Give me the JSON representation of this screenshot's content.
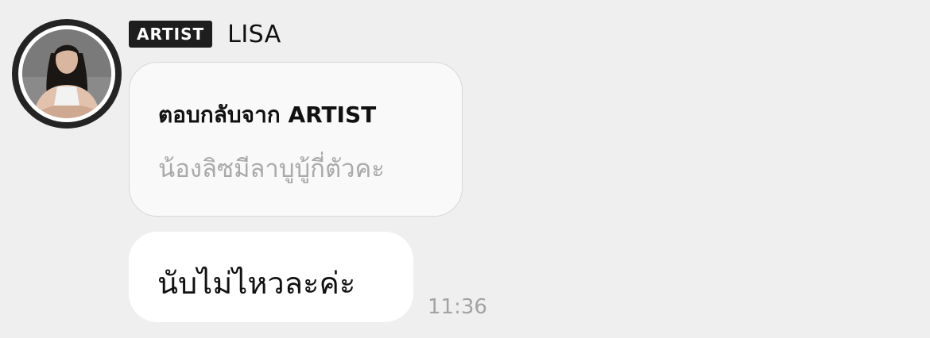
{
  "sender": {
    "badge": "ARTIST",
    "name": "LISA",
    "avatar_icon": "profile-photo"
  },
  "reply": {
    "label": "ตอบกลับจาก ARTIST",
    "quote": "น้องลิซมีลาบูบู้กี่ตัวคะ"
  },
  "message": {
    "text": "นับไม่ไหวละค่ะ",
    "time": "11:36"
  },
  "colors": {
    "background": "#efefef",
    "badge_bg": "#1e1e1e",
    "reply_bubble_bg": "#f9f9f9",
    "message_bubble_bg": "#ffffff",
    "muted_text": "#a9a9a9"
  }
}
